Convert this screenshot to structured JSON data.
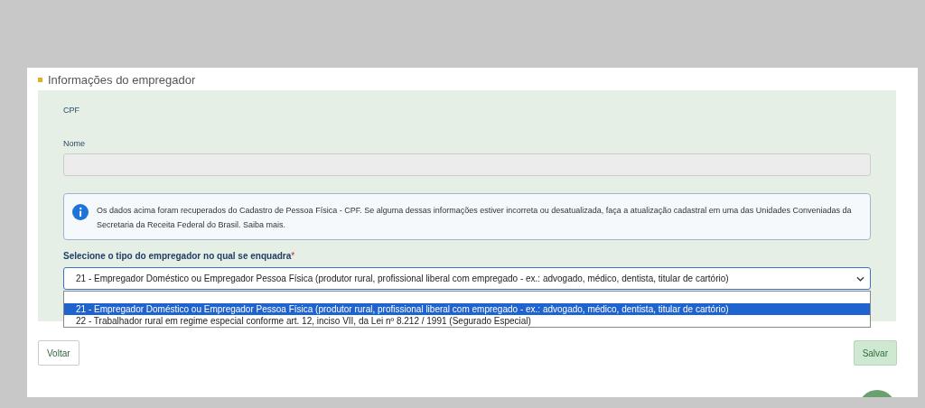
{
  "section": {
    "title": "Informações do empregador"
  },
  "cpf": {
    "label": "CPF"
  },
  "nome": {
    "label": "Nome"
  },
  "info": {
    "text": "Os dados acima foram recuperados do Cadastro de Pessoa Física - CPF. Se alguma dessas informações estiver incorreta ou desatualizada, faça a atualização cadastral em uma das Unidades Conveniadas da Secretaria da Receita Federal do Brasil. Saiba mais."
  },
  "employer_type": {
    "label": "Selecione o tipo do empregador no qual se enquadra",
    "required_mark": "*",
    "value": "21 - Empregador Doméstico ou Empregador Pessoa Física (produtor rural, profissional liberal com empregado - ex.: advogado, médico, dentista, titular de cartório)",
    "expanded": true,
    "options": [
      {
        "selected": false
      },
      {
        "label": "21 - Empregador Doméstico ou Empregador Pessoa Física (produtor rural, profissional liberal com empregado - ex.: advogado, médico, dentista, titular de cartório)",
        "selected": true
      },
      {
        "label": "22 - Trabalhador rural em regime especial conforme art. 12, inciso VII, da Lei nº 8.212 / 1991 (Segurado Especial)",
        "selected": false
      }
    ]
  },
  "buttons": {
    "back": "Voltar",
    "save": "Salvar"
  }
}
